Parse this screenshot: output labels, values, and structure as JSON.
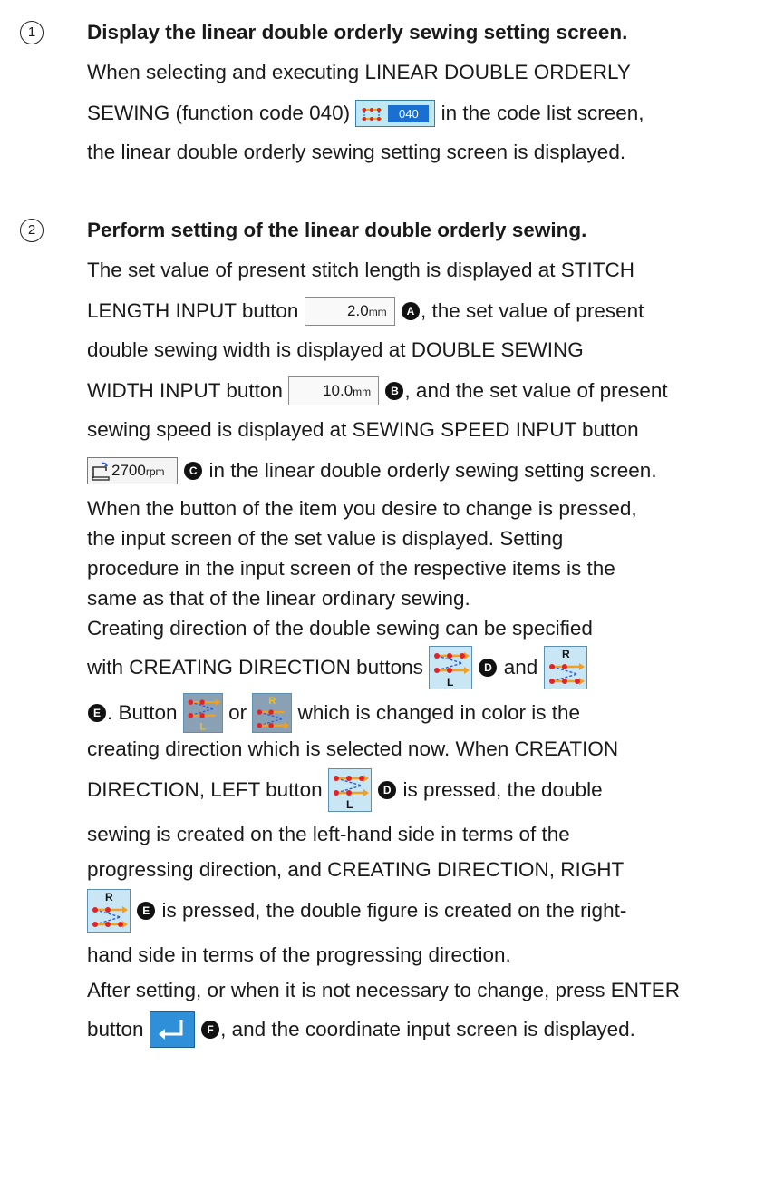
{
  "steps": [
    {
      "number": "1",
      "heading": "Display the linear double orderly sewing setting screen.",
      "line1": "When selecting and executing LINEAR DOUBLE ORDERLY",
      "line2_before": "SEWING (function code 040)",
      "code_button_label": "040",
      "line2_after": "in the code list screen,",
      "line3": "the linear double orderly sewing setting screen is displayed."
    },
    {
      "number": "2",
      "heading": "Perform setting of the linear double orderly sewing.",
      "p1_line1": "The set value of present stitch length is displayed at STITCH",
      "p1_line2_before": "LENGTH INPUT button",
      "stitch_length_value": "2.0",
      "stitch_length_unit": "mm",
      "marker_a": "A",
      "p1_line2_after": ", the set value of present",
      "p1_line3": "double sewing width is displayed at DOUBLE SEWING",
      "p1_line4_before": "WIDTH INPUT button",
      "width_value": "10.0",
      "width_unit": "mm",
      "marker_b": "B",
      "p1_line4_after": ", and the set value of present",
      "p1_line5": "sewing speed is displayed at SEWING SPEED INPUT button",
      "speed_value": "2700",
      "speed_unit": "rpm",
      "marker_c": "C",
      "p1_line6_after": "in the linear double orderly sewing setting screen.",
      "p2_line1": "When the button of the item you desire to change is pressed,",
      "p2_line2": "the input screen of the set value is displayed. Setting",
      "p2_line3": "procedure in the input screen of the respective items is the",
      "p2_line4": "same as that of the linear ordinary sewing.",
      "p3_line1": "Creating direction of the double sewing can be specified",
      "p3_line2_before": "with CREATING DIRECTION buttons",
      "marker_d": "D",
      "p3_and": "and",
      "marker_e": "E",
      "p3_line3_a": ". Button",
      "p3_line3_or": "or",
      "p3_line3_after": "which is changed in color is the",
      "p3_line4": "creating direction which is selected now. When CREATION",
      "p3_line5_before": "DIRECTION, LEFT button",
      "p3_line5_after": "is pressed, the double",
      "p3_line6": "sewing is created on the left-hand side in terms of the",
      "p3_line7": "progressing direction, and CREATING DIRECTION, RIGHT",
      "p3_line8_after": "is pressed, the double figure is created on the right-",
      "p3_line9": "hand side in terms of the progressing direction.",
      "p4_line1": "After setting, or when it is not necessary to change, press ENTER",
      "p4_line2_before": "button",
      "marker_f": "F",
      "p4_line2_after": ", and the coordinate input screen is displayed.",
      "dir_label_left": "L",
      "dir_label_right": "R"
    }
  ],
  "icons": {
    "code_icon": "double-stitch-icon",
    "speed_icon": "sewing-machine-icon",
    "dir_left_icon": "creating-direction-left-icon",
    "dir_right_icon": "creating-direction-right-icon",
    "enter_icon": "enter-return-icon"
  },
  "colors": {
    "code_box": "#1b6fd0",
    "dir_button": "#c9e6f5",
    "dir_button_selected": "#8aa0b5",
    "enter_button": "#2f8fd8",
    "stitch_red": "#e0222a",
    "arrow_orange": "#f0a020"
  }
}
